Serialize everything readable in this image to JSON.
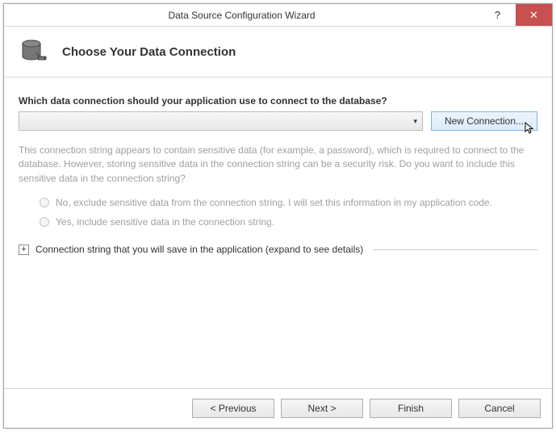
{
  "titlebar": {
    "title": "Data Source Configuration Wizard",
    "help": "?",
    "close": "✕"
  },
  "header": {
    "heading": "Choose Your Data Connection"
  },
  "content": {
    "question": "Which data connection should your application use to connect to the database?",
    "newConnection": "New Connection...",
    "sensitiveNote": "This connection string appears to contain sensitive data (for example, a password), which is required to connect to the database. However, storing sensitive data in the connection string can be a security risk. Do you want to include this sensitive data in the connection string?",
    "radioExclude": "No, exclude sensitive data from the connection string. I will set this information in my application code.",
    "radioInclude": "Yes, include sensitive data in the connection string.",
    "expandLabel": "Connection string that you will save in the application (expand to see details)",
    "expandGlyph": "+"
  },
  "footer": {
    "previous": "< Previous",
    "next": "Next >",
    "finish": "Finish",
    "cancel": "Cancel"
  }
}
